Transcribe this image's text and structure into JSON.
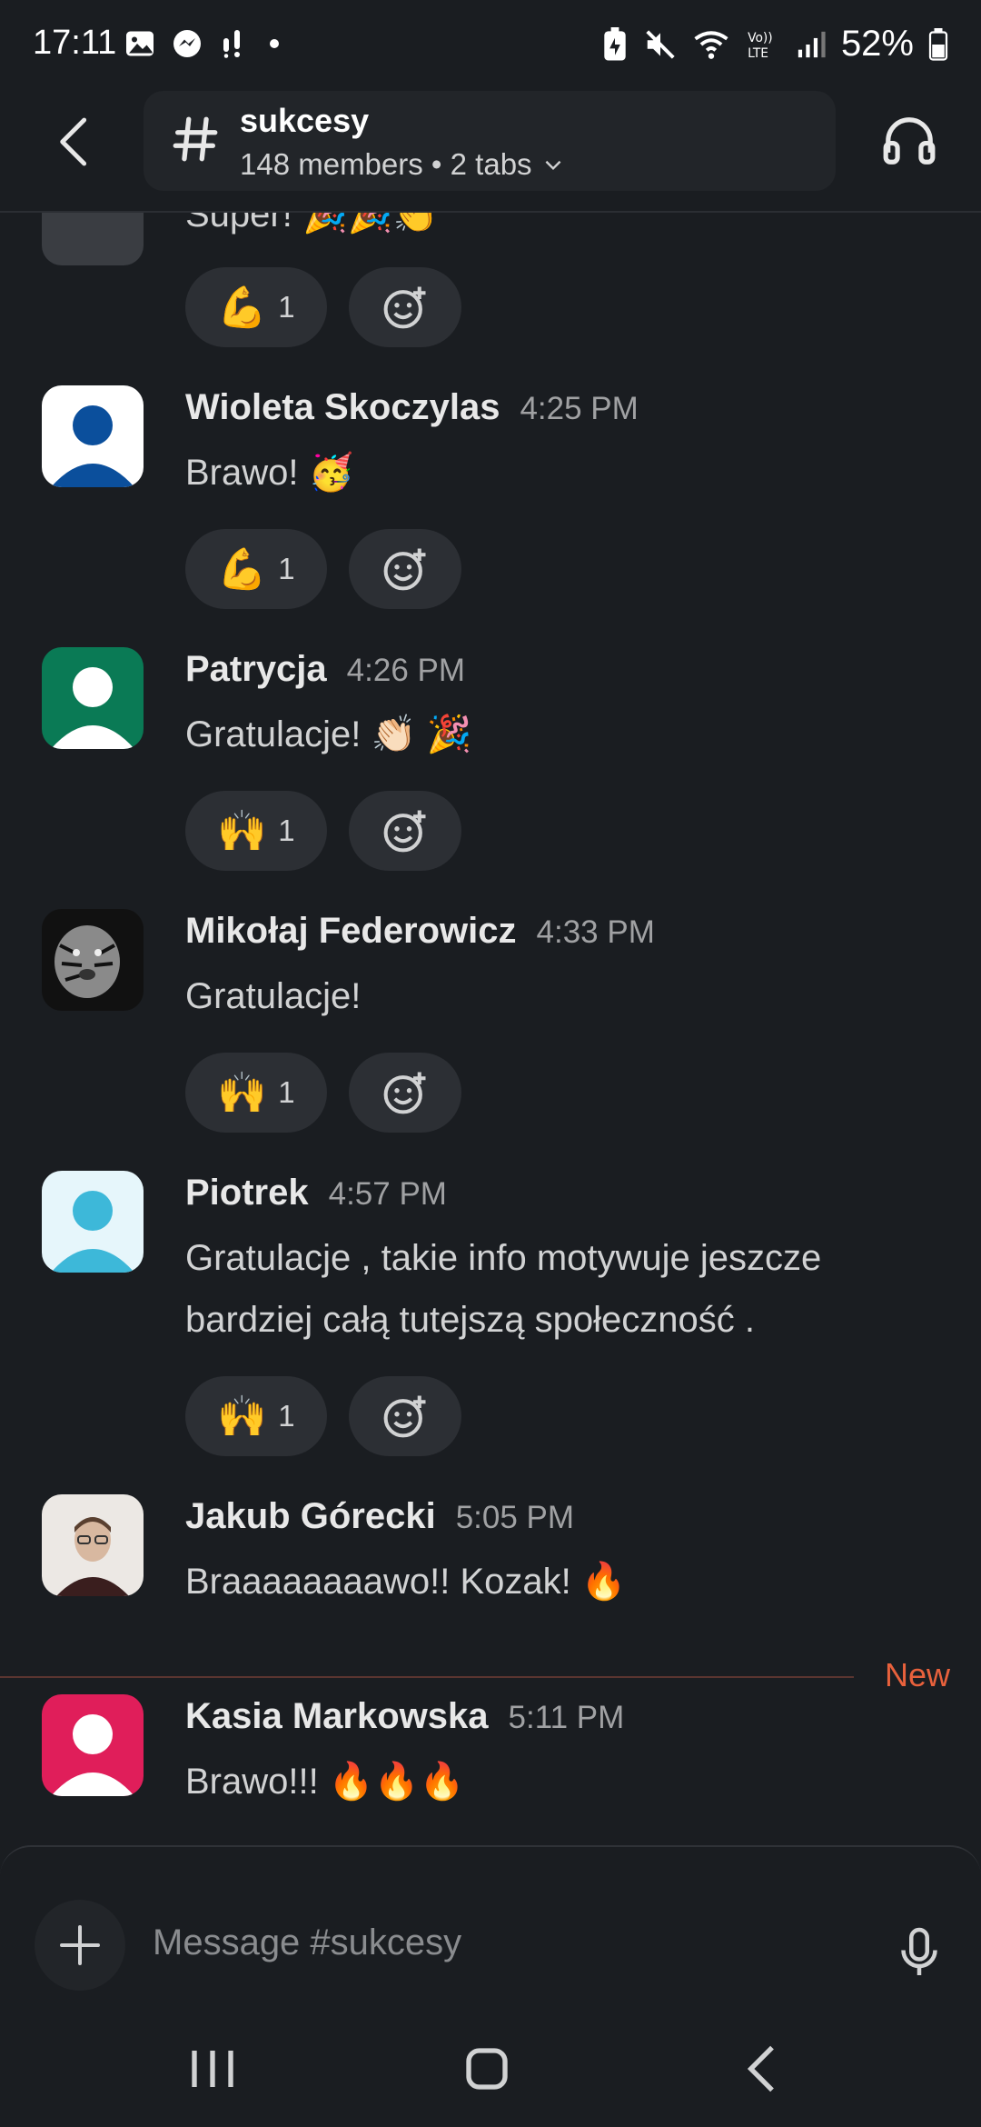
{
  "status_bar": {
    "time": "17:11",
    "battery": "52%",
    "left_icons": [
      "gallery-icon",
      "messenger-icon",
      "notification-icon",
      "dot-icon"
    ],
    "right_icons": [
      "battery-saver-icon",
      "mute-icon",
      "wifi-icon",
      "volte-icon",
      "signal-icon",
      "battery-icon"
    ]
  },
  "header": {
    "channel": "sukcesy",
    "meta": "148 members • 2 tabs"
  },
  "partial_message": {
    "text": "Super! 🎉🎉👏"
  },
  "messages": [
    {
      "author": "Wioleta Skoczylas",
      "time": "4:25 PM",
      "text": "Brawo! 🥳",
      "reaction_emoji": "💪",
      "reaction_count": "1",
      "avatar_color": "#0b4f9c"
    },
    {
      "author": "Patrycja",
      "time": "4:26 PM",
      "text": "Gratulacje! 👏🏻 🎉",
      "reaction_emoji": "🙌",
      "reaction_count": "1",
      "avatar_color": "#0a7a55"
    },
    {
      "author": "Mikołaj Federowicz",
      "time": "4:33 PM",
      "text": "Gratulacje!",
      "reaction_emoji": "🙌",
      "reaction_count": "1",
      "avatar_color": "#2b2b2b"
    },
    {
      "author": "Piotrek",
      "time": "4:57 PM",
      "text": "Gratulacje , takie info motywuje jeszcze bardziej całą tutejszą społeczność .",
      "reaction_emoji": "🙌",
      "reaction_count": "1",
      "avatar_color": "#3db8d9"
    },
    {
      "author": "Jakub Górecki",
      "time": "5:05 PM",
      "text": "Braaaaaaaawo!! Kozak! 🔥",
      "avatar_color": "#e9e4df"
    },
    {
      "author": "Kasia Markowska",
      "time": "5:11 PM",
      "text": "Brawo!!! 🔥🔥🔥",
      "avatar_color": "#e01e5a"
    }
  ],
  "partial_reaction": {
    "emoji": "💪",
    "count": "1"
  },
  "new_label": "New",
  "composer": {
    "placeholder": "Message #sukcesy"
  },
  "colors": {
    "background": "#1a1d21",
    "new_accent": "#e8613c"
  }
}
